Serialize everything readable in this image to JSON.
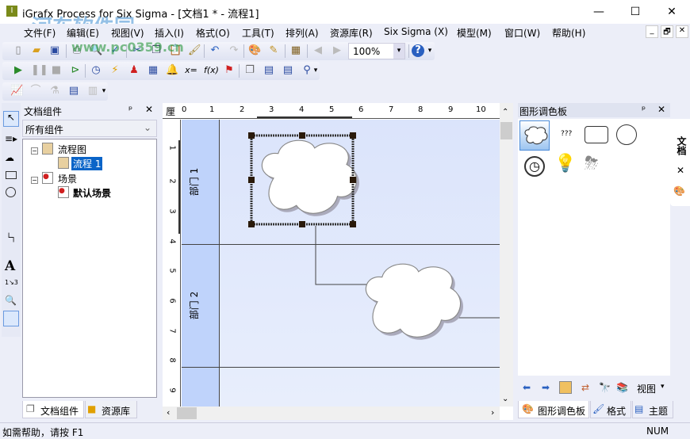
{
  "window": {
    "title": "iGrafx Process for Six Sigma - [文档1 * - 流程1]",
    "min": "—",
    "max": "☐",
    "close": "✕"
  },
  "watermark": {
    "text": "河东软件园",
    "url": "www.pc0359.cn"
  },
  "menu": [
    "文件(F)",
    "编辑(E)",
    "视图(V)",
    "插入(I)",
    "格式(O)",
    "工具(T)",
    "排列(A)",
    "资源库(R)",
    "Six Sigma (X)",
    "模型(M)",
    "窗口(W)",
    "帮助(H)"
  ],
  "mdi": {
    "min": "_",
    "restore": "🗗",
    "close": "✕"
  },
  "toolbar": {
    "zoom_value": "100%",
    "zoom_arrow": "▾",
    "overflow": "▾"
  },
  "left_panel": {
    "title": "文档组件",
    "pin": "ᵖ",
    "close": "✕",
    "filter": "所有组件",
    "tree": [
      {
        "label": "流程图",
        "children": [
          "流程 1"
        ]
      },
      {
        "label": "场景",
        "children": [
          "默认场景"
        ]
      }
    ],
    "tabs": [
      "文档组件",
      "资源库"
    ]
  },
  "canvas": {
    "ruler_unit": "厘",
    "h_ticks": [
      "0",
      "1",
      "2",
      "3",
      "4",
      "5",
      "6",
      "7",
      "8",
      "9",
      "10"
    ],
    "v_ticks": [
      "1",
      "2",
      "3",
      "4",
      "5",
      "6",
      "7",
      "8",
      "9"
    ],
    "lanes": [
      "部门 1",
      "部门 2",
      ""
    ]
  },
  "right_panel": {
    "title": "图形调色板",
    "pin": "ᵖ",
    "close": "✕",
    "shapes": [
      "cloud",
      "text",
      "rounded-rectangle",
      "circle",
      "clock",
      "lightbulb",
      "storm-cloud"
    ],
    "text_shape_label": "???",
    "view_label": "视图",
    "tabs": [
      "图形调色板",
      "格式",
      "主题"
    ],
    "side_tab": "文档",
    "side_close": "✕"
  },
  "status": {
    "help": "如需帮助，请按 F1",
    "num": "NUM"
  }
}
